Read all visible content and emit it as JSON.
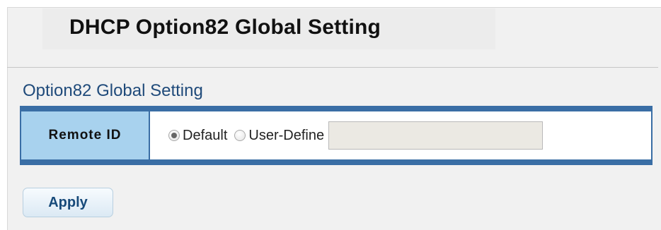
{
  "header": {
    "title": "DHCP Option82 Global Setting"
  },
  "section": {
    "title": "Option82 Global Setting"
  },
  "settings": {
    "remote_id": {
      "label": "Remote ID",
      "options": [
        {
          "label": "Default",
          "checked": true
        },
        {
          "label": "User-Define",
          "checked": false
        }
      ],
      "input_value": ""
    }
  },
  "actions": {
    "apply_label": "Apply"
  },
  "colors": {
    "section_title": "#1f4a7a",
    "table_border": "#3a6ea5",
    "row_header_bg": "#a8d2ee",
    "panel_bg": "#f1f1f1"
  }
}
